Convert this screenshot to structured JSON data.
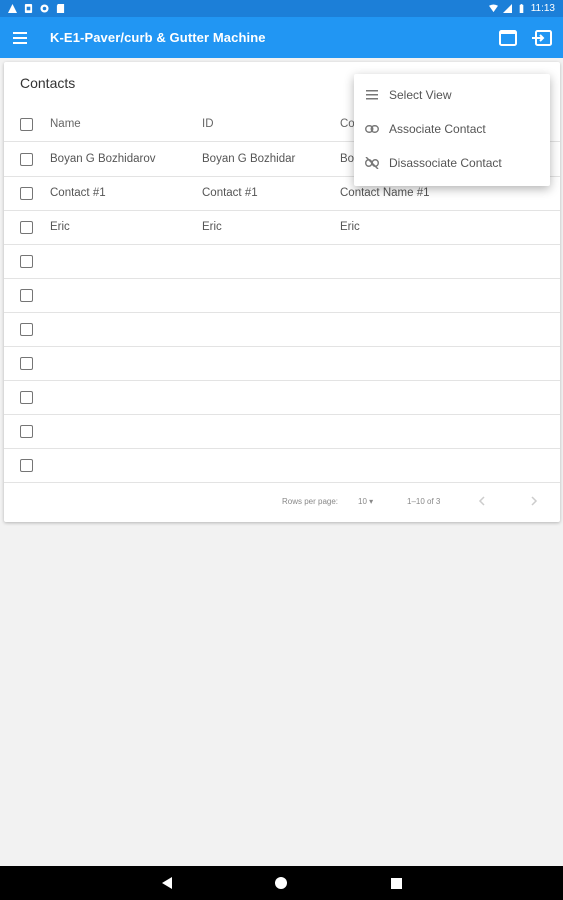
{
  "status_bar": {
    "time": "11:13"
  },
  "app_bar": {
    "title": "K-E1-Paver/curb & Gutter Machine",
    "menu_icon": "hamburger-menu-icon",
    "actions": [
      "window-icon",
      "exit-icon"
    ]
  },
  "card": {
    "title": "Contacts",
    "columns": [
      "Name",
      "ID",
      "Co"
    ],
    "rows": [
      {
        "c1": "Boyan G Bozhidarov",
        "c2": "Boyan G Bozhidar",
        "c3": "Bo"
      },
      {
        "c1": "Contact #1",
        "c2": "Contact #1",
        "c3": "Contact Name #1"
      },
      {
        "c1": "Eric",
        "c2": "Eric",
        "c3": "Eric"
      },
      {
        "c1": "",
        "c2": "",
        "c3": ""
      },
      {
        "c1": "",
        "c2": "",
        "c3": ""
      },
      {
        "c1": "",
        "c2": "",
        "c3": ""
      },
      {
        "c1": "",
        "c2": "",
        "c3": ""
      },
      {
        "c1": "",
        "c2": "",
        "c3": ""
      },
      {
        "c1": "",
        "c2": "",
        "c3": ""
      },
      {
        "c1": "",
        "c2": "",
        "c3": ""
      }
    ],
    "pager": {
      "rows_per_page_label": "Rows per page:",
      "rows_per_page_value": "10",
      "range": "1–10 of 3"
    }
  },
  "dropdown": {
    "items": [
      {
        "label": "Select View",
        "icon": "list-icon"
      },
      {
        "label": "Associate Contact",
        "icon": "link-icon"
      },
      {
        "label": "Disassociate Contact",
        "icon": "unlink-icon"
      }
    ]
  },
  "colors": {
    "status_bar": "#1c7fd8",
    "app_bar": "#2196f3"
  }
}
